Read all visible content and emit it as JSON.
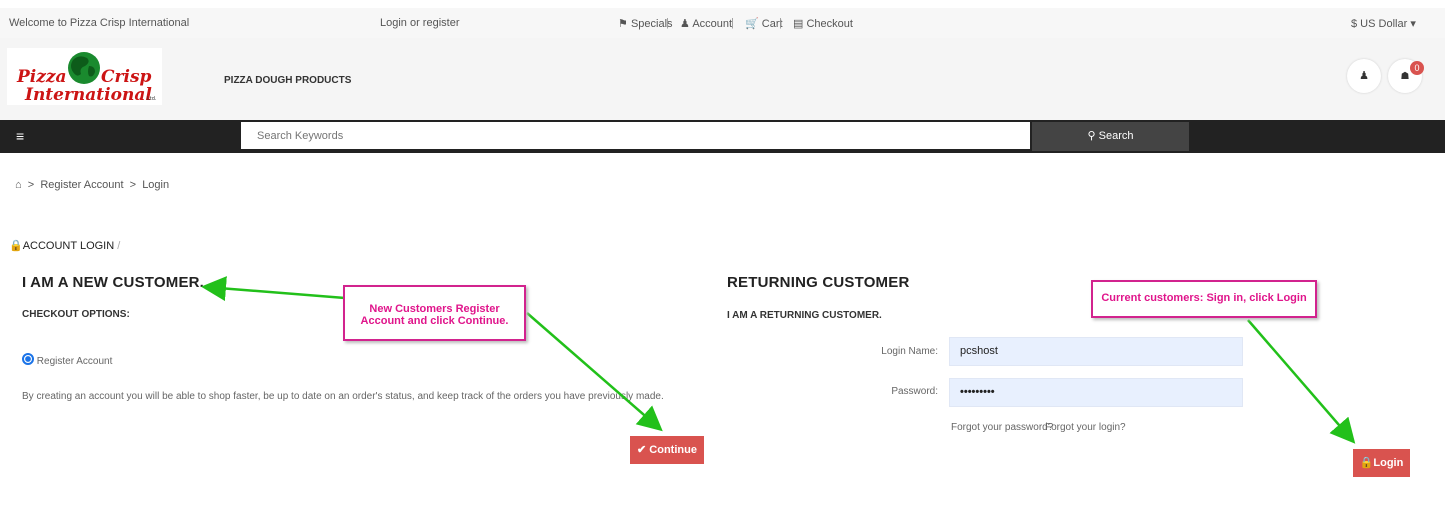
{
  "topbar": {
    "welcome": "Welcome to Pizza Crisp International",
    "login_register": "Login or register",
    "specials": "Specials",
    "account": "Account",
    "cart": "Cart",
    "checkout": "Checkout",
    "sep": "|",
    "currency": "$  US Dollar"
  },
  "header": {
    "logo_line1": "Pizza",
    "logo_line2": "Crisp",
    "logo_line3": "International",
    "logo_suffix": "Ltd.",
    "menu_item": "PIZZA DOUGH PRODUCTS",
    "cart_count": "0"
  },
  "search": {
    "placeholder": "Search Keywords",
    "button": "Search"
  },
  "breadcrumb": {
    "sep": ">",
    "items": [
      "Register Account",
      "Login"
    ]
  },
  "page": {
    "section_title": "ACCOUNT LOGIN",
    "section_sep": "/"
  },
  "new_customer": {
    "heading": "I AM A NEW CUSTOMER.",
    "subheading": "CHECKOUT OPTIONS:",
    "option": "Register Account",
    "description": "By creating an account you will be able to shop faster, be up to date on an order's status, and keep track of the orders you have previously made.",
    "continue": "Continue"
  },
  "returning": {
    "heading": "RETURNING CUSTOMER",
    "subheading": "I AM A RETURNING CUSTOMER.",
    "login_label": "Login Name:",
    "login_value": "pcshost",
    "password_label": "Password:",
    "password_value": "•••••••••",
    "forgot_password": "Forgot your password?",
    "forgot_login": "Forgot your login?",
    "login_button": "Login"
  },
  "annotations": {
    "new_customer_note": "New Customers Register Account and click Continue.",
    "returning_note": "Current customers: Sign in, click Login",
    "arrow_color": "#22c01a",
    "note_color": "#e0158b"
  },
  "colors": {
    "primary_red": "#d9534f",
    "dark_bar": "#222222"
  }
}
